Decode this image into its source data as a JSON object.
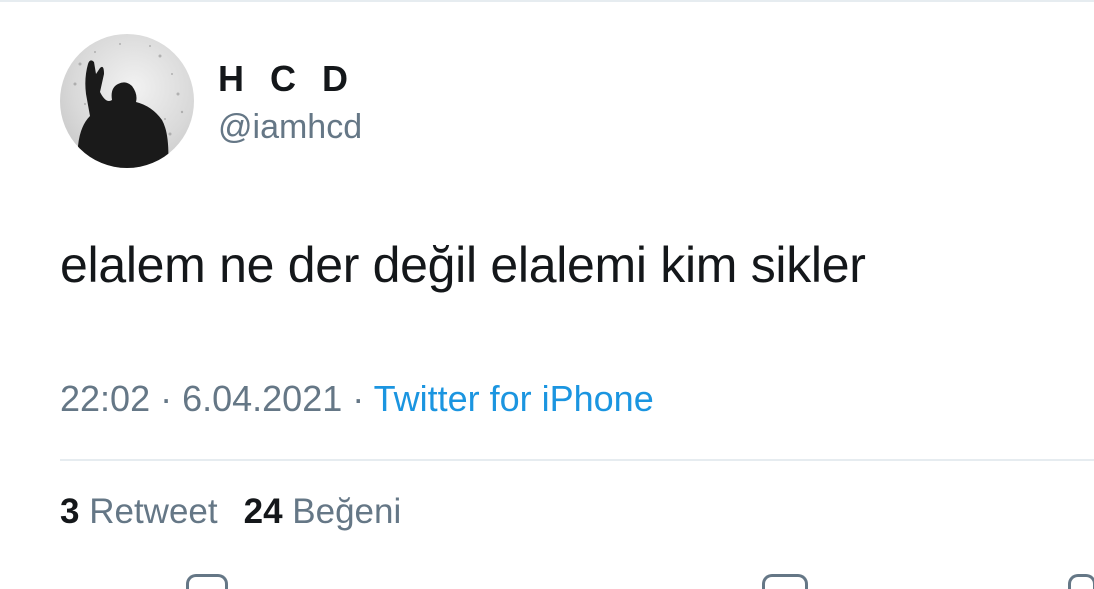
{
  "author": {
    "display_name": "H C D",
    "handle": "@iamhcd"
  },
  "tweet": {
    "text": "elalem ne der değil elalemi kim sikler",
    "time": "22:02",
    "date": "6.04.2021",
    "source": "Twitter for iPhone"
  },
  "stats": {
    "retweet_count": "3",
    "retweet_label": "Retweet",
    "like_count": "24",
    "like_label": "Beğeni"
  },
  "colors": {
    "text_primary": "#14171a",
    "text_secondary": "#657786",
    "link": "#1b95e0",
    "divider": "#e6ecf0"
  },
  "icons": {
    "avatar": "profile-photo",
    "actions": [
      "reply-icon",
      "like-icon",
      "share-icon"
    ]
  }
}
